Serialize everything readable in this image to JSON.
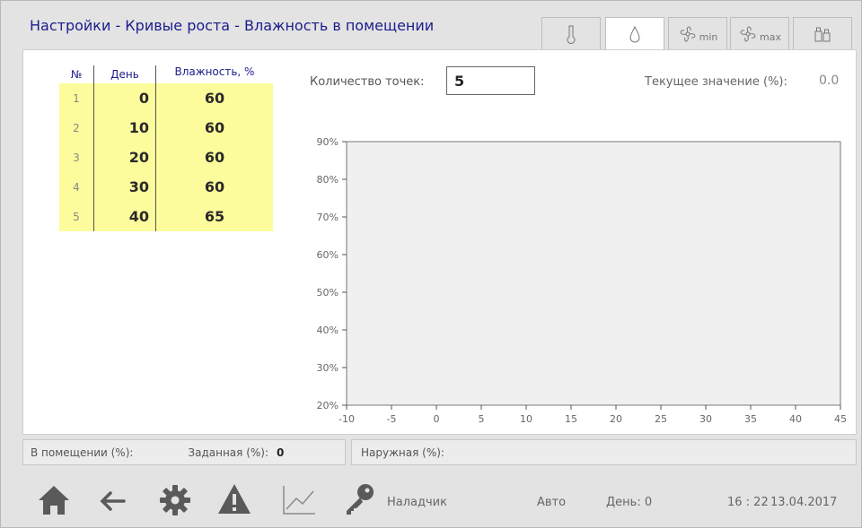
{
  "header": {
    "title": "Настройки - Кривые роста - Влажность в помещении"
  },
  "tabs": [
    {
      "name": "thermometer-icon",
      "sub": ""
    },
    {
      "name": "droplet-icon",
      "sub": ""
    },
    {
      "name": "fan-min-icon",
      "sub": "min"
    },
    {
      "name": "fan-max-icon",
      "sub": "max"
    },
    {
      "name": "bottles-icon",
      "sub": ""
    }
  ],
  "table": {
    "headers": [
      "№",
      "День",
      "Влажность, %"
    ],
    "rows": [
      [
        "1",
        "0",
        "60"
      ],
      [
        "2",
        "10",
        "60"
      ],
      [
        "3",
        "20",
        "60"
      ],
      [
        "4",
        "30",
        "60"
      ],
      [
        "5",
        "40",
        "65"
      ]
    ]
  },
  "points": {
    "label": "Количество точек:",
    "value": "5"
  },
  "current": {
    "label": "Текущее значение (%):",
    "value": "0.0"
  },
  "chart_data": {
    "type": "line",
    "x": [],
    "series": [],
    "xlim": [
      -10,
      45
    ],
    "ylim": [
      20,
      90
    ],
    "x_ticks": [
      "-10",
      "-5",
      "0",
      "5",
      "10",
      "15",
      "20",
      "25",
      "30",
      "35",
      "40",
      "45"
    ],
    "y_ticks": [
      "90%",
      "80%",
      "70%",
      "60%",
      "50%",
      "40%",
      "30%",
      "20%"
    ],
    "grid": false,
    "plot_bg": "#f0f0f0"
  },
  "status": {
    "indoor": "В помещении (%):",
    "set_label": "Заданная (%):",
    "set_value": "0",
    "outdoor": "Наружная (%):"
  },
  "footer": {
    "user": "Наладчик",
    "mode": "Авто",
    "day": "День: 0",
    "time": "16 : 22",
    "date": "13.04.2017"
  },
  "colors": {
    "title": "#1c1c8c",
    "table_bg": "#fdfc9c",
    "icon": "#555555"
  }
}
